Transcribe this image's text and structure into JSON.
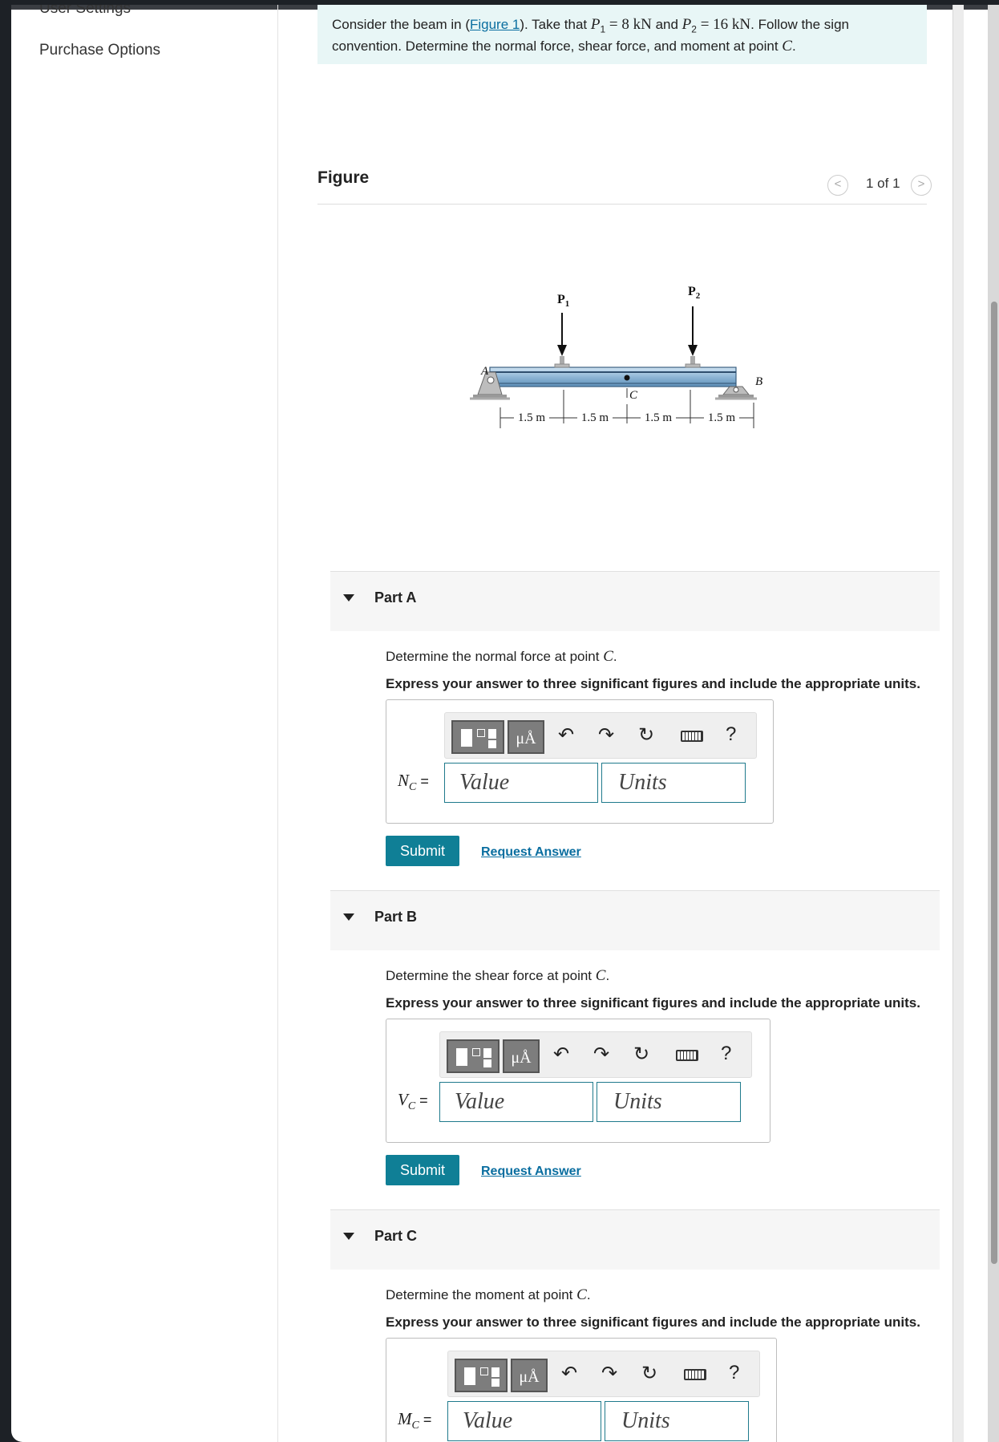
{
  "sidebar": {
    "items": [
      {
        "label": "User Settings"
      },
      {
        "label": "Purchase Options"
      }
    ]
  },
  "problem": {
    "intro": "Consider the beam in (",
    "figure_link": "Figure 1",
    "after_link": "). Take that ",
    "p1_sym": "P",
    "p1_sub": "1",
    "p1_value": " = 8 kN",
    "and": " and ",
    "p2_sym": "P",
    "p2_sub": "2",
    "p2_value": " = 16 kN",
    "rest1": ". Follow the sign",
    "line2": "convention. Determine the normal force, shear force, and moment at point ",
    "point": "C",
    "end": "."
  },
  "figure": {
    "title": "Figure",
    "pager": "1 of 1",
    "prev": "<",
    "next": ">",
    "labels": {
      "p1": "P",
      "p1_sub": "1",
      "p2": "P",
      "p2_sub": "2",
      "a": "A",
      "b": "B",
      "c": "C",
      "d1": "1.5 m",
      "d2": "1.5 m",
      "d3": "1.5 m",
      "d4": "1.5 m"
    }
  },
  "parts": [
    {
      "title": "Part A",
      "question_pre": "Determine the normal force at point ",
      "question_point": "C",
      "question_end": ".",
      "instruction": "Express your answer to three significant figures and include the appropriate units.",
      "var": "N",
      "var_sub": "C",
      "eq": " =",
      "value_placeholder": "Value",
      "units_placeholder": "Units",
      "submit": "Submit",
      "request": "Request Answer"
    },
    {
      "title": "Part B",
      "question_pre": "Determine the shear force at point ",
      "question_point": "C",
      "question_end": ".",
      "instruction": "Express your answer to three significant figures and include the appropriate units.",
      "var": "V",
      "var_sub": "C",
      "eq": " =",
      "value_placeholder": "Value",
      "units_placeholder": "Units",
      "submit": "Submit",
      "request": "Request Answer"
    },
    {
      "title": "Part C",
      "question_pre": "Determine the moment at point ",
      "question_point": "C",
      "question_end": ".",
      "instruction": "Express your answer to three significant figures and include the appropriate units.",
      "var": "M",
      "var_sub": "C",
      "eq": " =",
      "value_placeholder": "Value",
      "units_placeholder": "Units"
    }
  ],
  "toolbar": {
    "mu_label": "μÅ",
    "help": "?"
  }
}
